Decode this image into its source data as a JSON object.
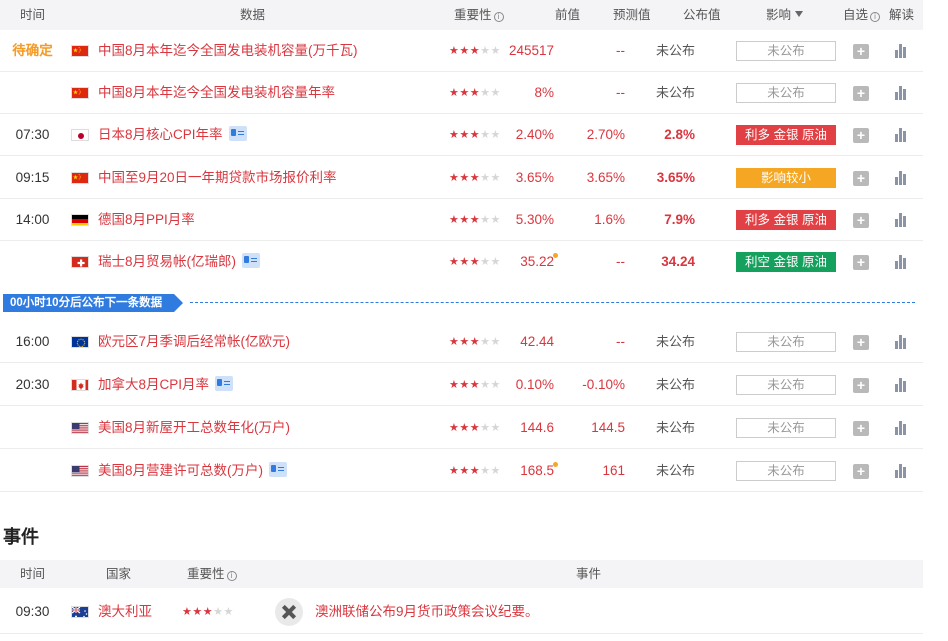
{
  "table_header": {
    "time": "时间",
    "data": "数据",
    "importance": "重要性",
    "previous": "前值",
    "forecast": "预测值",
    "actual": "公布值",
    "impact": "影响",
    "watch": "自选",
    "interpret": "解读"
  },
  "rows": [
    {
      "time": "待确定",
      "flag": "cn",
      "name": "中国8月本年迄今全国发电装机容量(万千瓦)",
      "stars": 3,
      "prev": "245517",
      "fore": "--",
      "actual": "未公布",
      "impact": "未公布",
      "impact_style": "none"
    },
    {
      "time": "",
      "flag": "cn",
      "name": "中国8月本年迄今全国发电装机容量年率",
      "stars": 3,
      "prev": "8%",
      "fore": "--",
      "actual": "未公布",
      "impact": "未公布",
      "impact_style": "none"
    },
    {
      "time": "07:30",
      "flag": "jp",
      "name": "日本8月核心CPI年率",
      "stars": 3,
      "prev": "2.40%",
      "fore": "2.70%",
      "actual": "2.8%",
      "impact": "利多 金银 原油",
      "impact_style": "red"
    },
    {
      "time": "09:15",
      "flag": "cn",
      "name": "中国至9月20日一年期贷款市场报价利率",
      "stars": 3,
      "prev": "3.65%",
      "fore": "3.65%",
      "actual": "3.65%",
      "impact": "影响较小",
      "impact_style": "yellow"
    },
    {
      "time": "14:00",
      "flag": "de",
      "name": "德国8月PPI月率",
      "stars": 3,
      "prev": "5.30%",
      "fore": "1.6%",
      "actual": "7.9%",
      "impact": "利多 金银 原油",
      "impact_style": "red"
    },
    {
      "time": "",
      "flag": "ch",
      "name": "瑞士8月贸易帐(亿瑞郎)",
      "stars": 3,
      "prev": "35.22",
      "fore": "--",
      "actual": "34.24",
      "impact": "利空 金银 原油",
      "impact_style": "green"
    },
    {
      "time": "16:00",
      "flag": "eu",
      "name": "欧元区7月季调后经常帐(亿欧元)",
      "stars": 3,
      "prev": "42.44",
      "fore": "--",
      "actual": "未公布",
      "impact": "未公布",
      "impact_style": "none"
    },
    {
      "time": "20:30",
      "flag": "ca",
      "name": "加拿大8月CPI月率",
      "stars": 3,
      "prev": "0.10%",
      "fore": "-0.10%",
      "actual": "未公布",
      "impact": "未公布",
      "impact_style": "none"
    },
    {
      "time": "",
      "flag": "us",
      "name": "美国8月新屋开工总数年化(万户)",
      "stars": 3,
      "prev": "144.6",
      "fore": "144.5",
      "actual": "未公布",
      "impact": "未公布",
      "impact_style": "none"
    },
    {
      "time": "",
      "flag": "us",
      "name": "美国8月营建许可总数(万户)",
      "stars": 3,
      "prev": "168.5",
      "fore": "161",
      "actual": "未公布",
      "impact": "未公布",
      "impact_style": "none"
    }
  ],
  "countdown": "00小时10分后公布下一条数据",
  "events": {
    "title": "事件",
    "header": {
      "time": "时间",
      "country": "国家",
      "importance": "重要性",
      "event": "事件"
    },
    "rows": [
      {
        "time": "09:30",
        "flag": "au",
        "country": "澳大利亚",
        "stars": 3,
        "event": "澳洲联储公布9月货币政策会议纪要。"
      }
    ]
  }
}
